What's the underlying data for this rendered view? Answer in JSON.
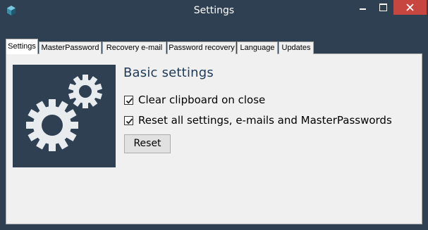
{
  "window": {
    "title": "Settings"
  },
  "title_bar": {
    "icon": "app-cube-icon",
    "controls": [
      "minimize-icon",
      "maximize-icon",
      "close-icon"
    ],
    "close_color": "#c7463f"
  },
  "tabs": [
    {
      "label": "Settings",
      "active": true
    },
    {
      "label": "MasterPassword",
      "active": false
    },
    {
      "label": "Recovery e-mail",
      "active": false
    },
    {
      "label": "Password recovery",
      "active": false
    },
    {
      "label": "Language",
      "active": false
    },
    {
      "label": "Updates",
      "active": false
    }
  ],
  "settings": {
    "heading": "Basic settings",
    "image_icon": "gears-icon",
    "checkboxes": [
      {
        "label": "Clear clipboard on close",
        "checked": true
      },
      {
        "label": "Reset all settings, e-mails and MasterPasswords",
        "checked": true
      }
    ],
    "reset_button": "Reset"
  },
  "colors": {
    "frame": "#2f4053",
    "heading_text": "#1e3956",
    "panel_bg": "#f0f0f0"
  }
}
